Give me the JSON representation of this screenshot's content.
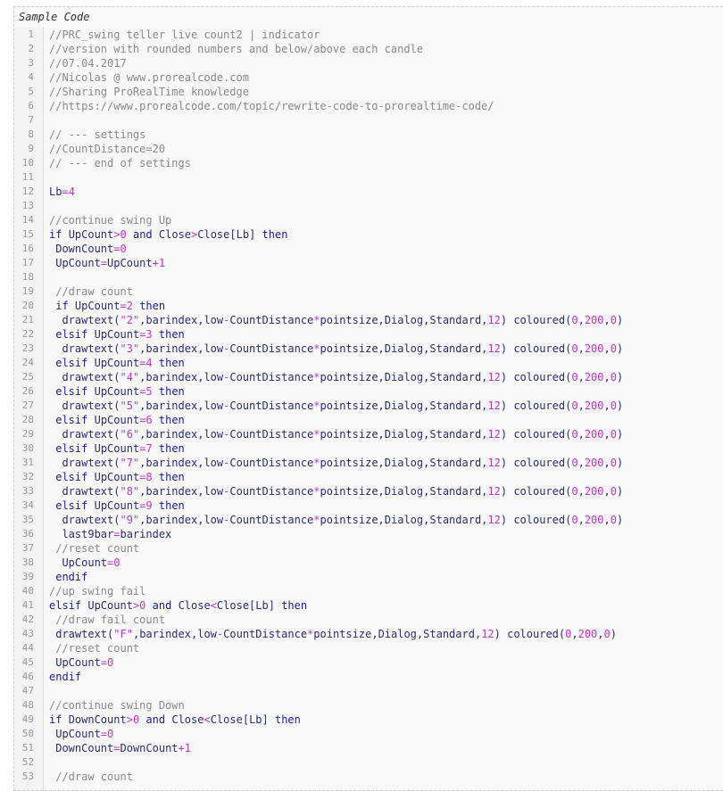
{
  "title": "Sample Code",
  "lines": [
    {
      "n": "1",
      "t": "//PRC_swing teller live count2 | indicator",
      "c": "comment"
    },
    {
      "n": "2",
      "t": "//version with rounded numbers and below/above each candle",
      "c": "comment"
    },
    {
      "n": "3",
      "t": "//07.04.2017",
      "c": "comment"
    },
    {
      "n": "4",
      "t": "//Nicolas @ www.prorealcode.com",
      "c": "comment"
    },
    {
      "n": "5",
      "t": "//Sharing ProRealTime knowledge",
      "c": "comment"
    },
    {
      "n": "6",
      "t": "//https://www.prorealcode.com/topic/rewrite-code-to-prorealtime-code/",
      "c": "comment"
    },
    {
      "n": "7",
      "t": "",
      "c": ""
    },
    {
      "n": "8",
      "t": "// --- settings",
      "c": "comment"
    },
    {
      "n": "9",
      "t": "//CountDistance=20",
      "c": "comment"
    },
    {
      "n": "10",
      "t": "// --- end of settings",
      "c": "comment"
    },
    {
      "n": "11",
      "t": "",
      "c": ""
    },
    {
      "n": "12",
      "t": "Lb=4",
      "c": "code"
    },
    {
      "n": "13",
      "t": "",
      "c": ""
    },
    {
      "n": "14",
      "t": "//continue swing Up",
      "c": "comment"
    },
    {
      "n": "15",
      "t": "if UpCount>0 and Close>Close[Lb] then",
      "c": "code"
    },
    {
      "n": "16",
      "t": " DownCount=0",
      "c": "code"
    },
    {
      "n": "17",
      "t": " UpCount=UpCount+1",
      "c": "code"
    },
    {
      "n": "18",
      "t": "",
      "c": ""
    },
    {
      "n": "19",
      "t": " //draw count",
      "c": "comment"
    },
    {
      "n": "20",
      "t": " if UpCount=2 then",
      "c": "code"
    },
    {
      "n": "21",
      "t": "  drawtext(\"2\",barindex,low-CountDistance*pointsize,Dialog,Standard,12) coloured(0,200,0)",
      "c": "code"
    },
    {
      "n": "22",
      "t": " elsif UpCount=3 then",
      "c": "code"
    },
    {
      "n": "23",
      "t": "  drawtext(\"3\",barindex,low-CountDistance*pointsize,Dialog,Standard,12) coloured(0,200,0)",
      "c": "code"
    },
    {
      "n": "24",
      "t": " elsif UpCount=4 then",
      "c": "code"
    },
    {
      "n": "25",
      "t": "  drawtext(\"4\",barindex,low-CountDistance*pointsize,Dialog,Standard,12) coloured(0,200,0)",
      "c": "code"
    },
    {
      "n": "26",
      "t": " elsif UpCount=5 then",
      "c": "code"
    },
    {
      "n": "27",
      "t": "  drawtext(\"5\",barindex,low-CountDistance*pointsize,Dialog,Standard,12) coloured(0,200,0)",
      "c": "code"
    },
    {
      "n": "28",
      "t": " elsif UpCount=6 then",
      "c": "code"
    },
    {
      "n": "29",
      "t": "  drawtext(\"6\",barindex,low-CountDistance*pointsize,Dialog,Standard,12) coloured(0,200,0)",
      "c": "code"
    },
    {
      "n": "30",
      "t": " elsif UpCount=7 then",
      "c": "code"
    },
    {
      "n": "31",
      "t": "  drawtext(\"7\",barindex,low-CountDistance*pointsize,Dialog,Standard,12) coloured(0,200,0)",
      "c": "code"
    },
    {
      "n": "32",
      "t": " elsif UpCount=8 then",
      "c": "code"
    },
    {
      "n": "33",
      "t": "  drawtext(\"8\",barindex,low-CountDistance*pointsize,Dialog,Standard,12) coloured(0,200,0)",
      "c": "code"
    },
    {
      "n": "34",
      "t": " elsif UpCount=9 then",
      "c": "code"
    },
    {
      "n": "35",
      "t": "  drawtext(\"9\",barindex,low-CountDistance*pointsize,Dialog,Standard,12) coloured(0,200,0)",
      "c": "code"
    },
    {
      "n": "36",
      "t": "  last9bar=barindex",
      "c": "code"
    },
    {
      "n": "37",
      "t": " //reset count",
      "c": "comment"
    },
    {
      "n": "38",
      "t": "  UpCount=0",
      "c": "code"
    },
    {
      "n": "39",
      "t": " endif",
      "c": "code"
    },
    {
      "n": "40",
      "t": "//up swing fail",
      "c": "comment"
    },
    {
      "n": "41",
      "t": "elsif UpCount>0 and Close<Close[Lb] then",
      "c": "code"
    },
    {
      "n": "42",
      "t": " //draw fail count",
      "c": "comment"
    },
    {
      "n": "43",
      "t": " drawtext(\"F\",barindex,low-CountDistance*pointsize,Dialog,Standard,12) coloured(0,200,0)",
      "c": "code"
    },
    {
      "n": "44",
      "t": " //reset count",
      "c": "comment"
    },
    {
      "n": "45",
      "t": " UpCount=0",
      "c": "code"
    },
    {
      "n": "46",
      "t": "endif",
      "c": "code"
    },
    {
      "n": "47",
      "t": "",
      "c": ""
    },
    {
      "n": "48",
      "t": "//continue swing Down",
      "c": "comment"
    },
    {
      "n": "49",
      "t": "if DownCount>0 and Close<Close[Lb] then",
      "c": "code"
    },
    {
      "n": "50",
      "t": " UpCount=0",
      "c": "code"
    },
    {
      "n": "51",
      "t": " DownCount=DownCount+1",
      "c": "code"
    },
    {
      "n": "52",
      "t": "",
      "c": ""
    },
    {
      "n": "53",
      "t": " //draw count",
      "c": "comment"
    }
  ]
}
